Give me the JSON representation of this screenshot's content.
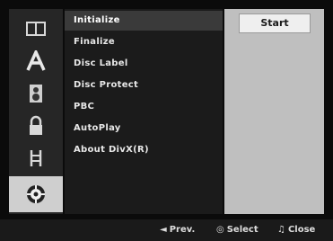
{
  "left_icons": [
    {
      "name": "book-icon"
    },
    {
      "name": "language-a-icon"
    },
    {
      "name": "speaker-icon"
    },
    {
      "name": "lock-icon"
    },
    {
      "name": "film-reel-icon"
    },
    {
      "name": "disc-settings-icon",
      "active": true
    }
  ],
  "menu": {
    "items": [
      {
        "label": "Initialize",
        "selected": true
      },
      {
        "label": "Finalize"
      },
      {
        "label": "Disc Label"
      },
      {
        "label": "Disc Protect"
      },
      {
        "label": "PBC"
      },
      {
        "label": "AutoPlay"
      },
      {
        "label": "About DivX(R)"
      }
    ]
  },
  "right_panel": {
    "start_label": "Start"
  },
  "bottom_bar": {
    "prev": {
      "icon": "◄",
      "label": "Prev."
    },
    "select": {
      "icon": "◎",
      "label": "Select"
    },
    "close": {
      "icon": "♫",
      "label": "Close"
    }
  }
}
